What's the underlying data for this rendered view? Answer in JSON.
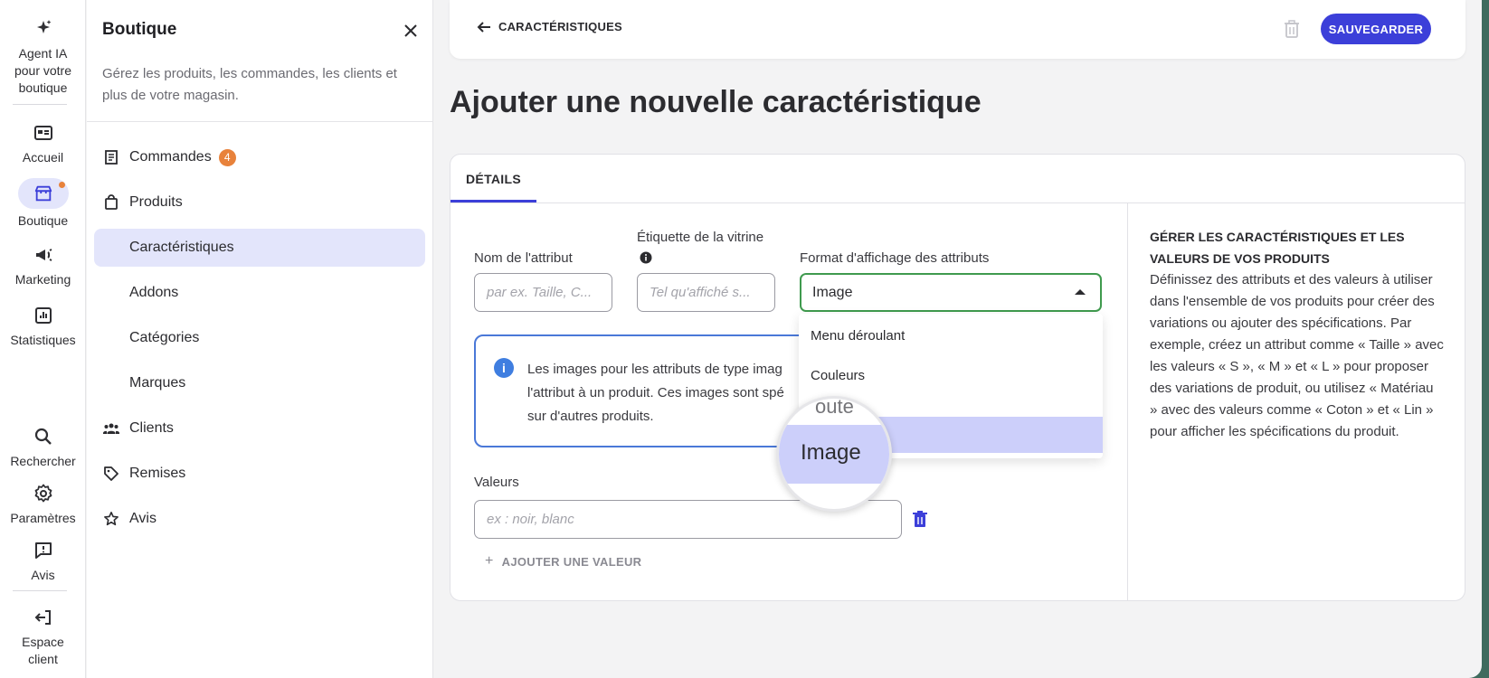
{
  "rail": {
    "agent_label_1": "Agent IA",
    "agent_label_2": "pour votre",
    "agent_label_3": "boutique",
    "home_label": "Accueil",
    "shop_label": "Boutique",
    "marketing_label": "Marketing",
    "stats_label": "Statistiques",
    "search_label": "Rechercher",
    "settings_label": "Paramètres",
    "reviews_label": "Avis",
    "client_label_1": "Espace",
    "client_label_2": "client",
    "accent_color": "#3c3fd9",
    "notification_color": "#e8823b"
  },
  "panel": {
    "title": "Boutique",
    "description": "Gérez les produits, les commandes, les clients et plus de votre magasin.",
    "items": [
      {
        "label": "Commandes",
        "badge": "4",
        "icon": "receipt-icon"
      },
      {
        "label": "Produits",
        "icon": "shopping-bag-icon"
      },
      {
        "label": "Caractéristiques",
        "active": true
      },
      {
        "label": "Addons"
      },
      {
        "label": "Catégories"
      },
      {
        "label": "Marques"
      },
      {
        "label": "Clients",
        "icon": "users-icon"
      },
      {
        "label": "Remises",
        "icon": "tag-icon"
      },
      {
        "label": "Avis",
        "icon": "star-icon"
      }
    ]
  },
  "header": {
    "back_label": "CARACTÉRISTIQUES",
    "save_label": "SAUVEGARDER"
  },
  "page": {
    "title": "Ajouter une nouvelle caractéristique"
  },
  "form": {
    "tab_label": "DÉTAILS",
    "attribute_name_label": "Nom de l'attribut",
    "attribute_name_placeholder": "par ex. Taille, C...",
    "storefront_label": "Étiquette de la vitrine",
    "storefront_placeholder": "Tel qu'affiché s...",
    "display_format_label": "Format d'affichage des attributs",
    "display_format_value": "Image",
    "display_format_options": [
      "Menu déroulant",
      "Couleurs",
      "Image"
    ],
    "info_line_1": "Les images pour les attributs de type imag",
    "info_line_2": "l'attribut à un produit. Ces images sont spé",
    "info_line_3": "sur d'autres produits.",
    "values_label": "Valeurs",
    "values_placeholder": "ex : noir, blanc",
    "add_value_label": "AJOUTER UNE VALEUR",
    "magnifier_ghost": "oute",
    "magnifier_label": "Image"
  },
  "help": {
    "title": "GÉRER LES CARACTÉRISTIQUES ET LES VALEURS DE VOS PRODUITS",
    "body": "Définissez des attributs et des valeurs à utiliser dans l'ensemble de vos produits pour créer des variations ou ajouter des spécifications. Par exemple, créez un attribut comme « Taille » avec les valeurs « S », « M » et « L » pour proposer des variations de produit, ou utilisez « Matériau » avec des valeurs comme « Coton » et « Lin » pour afficher les spécifications du produit."
  }
}
